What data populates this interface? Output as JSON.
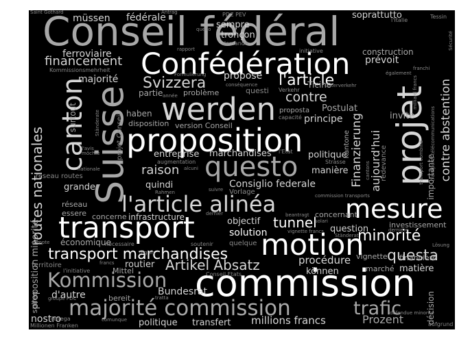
{
  "image": {
    "description_type": "word-cloud",
    "background": "#000000",
    "palette": {
      "white": "#ffffff",
      "light": "#d6d6d6",
      "gray": "#a8a8a8",
      "dim": "#8a8a8a"
    }
  },
  "words": [
    {
      "text": "Conseil fédéral",
      "color": "#a8a8a8"
    },
    {
      "text": "Confédération",
      "color": "#ffffff"
    },
    {
      "text": "werden",
      "color": "#d6d6d6"
    },
    {
      "text": "proposition",
      "color": "#ffffff"
    },
    {
      "text": "Suisse",
      "color": "#a8a8a8"
    },
    {
      "text": "canton",
      "color": "#d6d6d6"
    },
    {
      "text": "projet",
      "color": "#d6d6d6"
    },
    {
      "text": "questo",
      "color": "#a8a8a8"
    },
    {
      "text": "l'article alinéa",
      "color": "#d6d6d6"
    },
    {
      "text": "mesure",
      "color": "#ffffff"
    },
    {
      "text": "transport",
      "color": "#ffffff"
    },
    {
      "text": "motion",
      "color": "#ffffff"
    },
    {
      "text": "commission",
      "color": "#ffffff"
    },
    {
      "text": "majorité commission",
      "color": "#a8a8a8"
    },
    {
      "text": "Kommission",
      "color": "#a8a8a8"
    },
    {
      "text": "transport marchandises",
      "color": "#ffffff"
    },
    {
      "text": "Artikel Absatz",
      "color": "#d6d6d6"
    },
    {
      "text": "trafic",
      "color": "#a8a8a8"
    },
    {
      "text": "routes nationales",
      "color": "#d6d6d6"
    },
    {
      "text": "Svizzera",
      "color": "#d6d6d6"
    },
    {
      "text": "l'article",
      "color": "#ffffff"
    },
    {
      "text": "contre",
      "color": "#d6d6d6"
    },
    {
      "text": "minorité",
      "color": "#ffffff"
    },
    {
      "text": "questa",
      "color": "#d6d6d6"
    },
    {
      "text": "financement",
      "color": "#d6d6d6"
    },
    {
      "text": "Finanzierung",
      "color": "#d6d6d6"
    },
    {
      "text": "contre abstention",
      "color": "#d6d6d6"
    },
    {
      "text": "aujourd'hui",
      "color": "#d6d6d6"
    },
    {
      "text": "raison",
      "color": "#d6d6d6"
    },
    {
      "text": "tunnel",
      "color": "#ffffff"
    },
    {
      "text": "Prozent",
      "color": "#a8a8a8"
    },
    {
      "text": "millions francs",
      "color": "#d6d6d6"
    },
    {
      "text": "Consiglio federale",
      "color": "#d6d6d6"
    },
    {
      "text": "solution",
      "color": "#ffffff"
    },
    {
      "text": "procédure",
      "color": "#d6d6d6"
    },
    {
      "text": "Bundesrat",
      "color": "#d6d6d6"
    },
    {
      "text": "d'autre",
      "color": "#d6d6d6"
    },
    {
      "text": "nostro",
      "color": "#d6d6d6"
    },
    {
      "text": "politique",
      "color": "#d6d6d6"
    },
    {
      "text": "transfert",
      "color": "#d6d6d6"
    },
    {
      "text": "müssen",
      "color": "#d6d6d6"
    },
    {
      "text": "fédérale",
      "color": "#d6d6d6"
    },
    {
      "text": "soprattutto",
      "color": "#d6d6d6"
    },
    {
      "text": "ferroviaire",
      "color": "#d6d6d6"
    },
    {
      "text": "prévoit",
      "color": "#d6d6d6"
    },
    {
      "text": "majorité",
      "color": "#d6d6d6"
    },
    {
      "text": "propose",
      "color": "#d6d6d6"
    },
    {
      "text": "sempre",
      "color": "#d6d6d6"
    },
    {
      "text": "tronçon",
      "color": "#d6d6d6"
    },
    {
      "text": "principe",
      "color": "#d6d6d6"
    },
    {
      "text": "Postulat",
      "color": "#a8a8a8"
    },
    {
      "text": "entreprise",
      "color": "#d6d6d6"
    },
    {
      "text": "marchandises",
      "color": "#d6d6d6"
    },
    {
      "text": "politique",
      "color": "#d6d6d6"
    },
    {
      "text": "manière",
      "color": "#d6d6d6"
    },
    {
      "text": "grande",
      "color": "#d6d6d6"
    },
    {
      "text": "quindi",
      "color": "#d6d6d6"
    },
    {
      "text": "objectif",
      "color": "#d6d6d6"
    },
    {
      "text": "question",
      "color": "#d6d6d6"
    },
    {
      "text": "économique",
      "color": "#a8a8a8"
    },
    {
      "text": "routier",
      "color": "#d6d6d6"
    },
    {
      "text": "können",
      "color": "#d6d6d6"
    },
    {
      "text": "matière",
      "color": "#d6d6d6"
    },
    {
      "text": "vignette",
      "color": "#a8a8a8"
    },
    {
      "text": "financière",
      "color": "#a8a8a8"
    },
    {
      "text": "importante",
      "color": "#a8a8a8"
    },
    {
      "text": "invite",
      "color": "#a8a8a8"
    },
    {
      "text": "construction",
      "color": "#a8a8a8"
    },
    {
      "text": "infrastructure",
      "color": "#d6d6d6"
    },
    {
      "text": "concerne",
      "color": "#a8a8a8"
    },
    {
      "text": "partie",
      "color": "#a8a8a8"
    },
    {
      "text": "problème",
      "color": "#a8a8a8"
    },
    {
      "text": "haben",
      "color": "#a8a8a8"
    },
    {
      "text": "disposition",
      "color": "#a8a8a8"
    },
    {
      "text": "version Conseil",
      "color": "#a8a8a8"
    },
    {
      "text": "proposition minorité",
      "color": "#a8a8a8"
    },
    {
      "text": "surtout",
      "color": "#a8a8a8"
    },
    {
      "text": "Ticino",
      "color": "#a8a8a8"
    },
    {
      "text": "proposta",
      "color": "#a8a8a8"
    },
    {
      "text": "Kantone",
      "color": "#a8a8a8"
    },
    {
      "text": "décision",
      "color": "#a8a8a8"
    },
    {
      "text": "essere",
      "color": "#a8a8a8"
    },
    {
      "text": "réseau",
      "color": "#a8a8a8"
    },
    {
      "text": "sollen",
      "color": "#a8a8a8"
    },
    {
      "text": "bereit",
      "color": "#a8a8a8"
    },
    {
      "text": "marché",
      "color": "#a8a8a8"
    },
    {
      "text": "investissement",
      "color": "#a8a8a8"
    },
    {
      "text": "concernant",
      "color": "#a8a8a8"
    },
    {
      "text": "Mittel",
      "color": "#a8a8a8"
    },
    {
      "text": "territoire",
      "color": "#8a8a8a"
    },
    {
      "text": "quelque",
      "color": "#8a8a8a"
    },
    {
      "text": "soutenir",
      "color": "#8a8a8a"
    },
    {
      "text": "Saint Gothard",
      "color": "#8a8a8a"
    },
    {
      "text": "Antrag",
      "color": "#8a8a8a"
    },
    {
      "text": "PDC PEV",
      "color": "#8a8a8a"
    },
    {
      "text": "Tessin",
      "color": "#8a8a8a"
    },
    {
      "text": "l'Italie",
      "color": "#8a8a8a"
    },
    {
      "text": "quello",
      "color": "#8a8a8a"
    },
    {
      "text": "demande",
      "color": "#8a8a8a"
    },
    {
      "text": "initiative",
      "color": "#8a8a8a"
    },
    {
      "text": "Kommissionsmehrheit",
      "color": "#8a8a8a"
    },
    {
      "text": "rapport",
      "color": "#8a8a8a"
    },
    {
      "text": "Formulierung",
      "color": "#8a8a8a"
    },
    {
      "text": "conséquence",
      "color": "#8a8a8a"
    },
    {
      "text": "questi",
      "color": "#8a8a8a"
    },
    {
      "text": "Verkehr",
      "color": "#8a8a8a"
    },
    {
      "text": "capacité",
      "color": "#8a8a8a"
    },
    {
      "text": "Strasse",
      "color": "#8a8a8a"
    },
    {
      "text": "l'Etat",
      "color": "#8a8a8a"
    },
    {
      "text": "Vorlage",
      "color": "#8a8a8a"
    },
    {
      "text": "suivre",
      "color": "#8a8a8a"
    },
    {
      "text": "Rahmen",
      "color": "#8a8a8a"
    },
    {
      "text": "réseau routes",
      "color": "#8a8a8a"
    },
    {
      "text": "nationale",
      "color": "#8a8a8a"
    },
    {
      "text": "compte",
      "color": "#8a8a8a"
    },
    {
      "text": "nécessaire",
      "color": "#8a8a8a"
    },
    {
      "text": "région",
      "color": "#8a8a8a"
    },
    {
      "text": "francs",
      "color": "#8a8a8a"
    },
    {
      "text": "l'initiative",
      "color": "#8a8a8a"
    },
    {
      "text": "Conseil Etats",
      "color": "#8a8a8a"
    },
    {
      "text": "groupe PDC",
      "color": "#8a8a8a"
    },
    {
      "text": "collega",
      "color": "#8a8a8a"
    },
    {
      "text": "comunque",
      "color": "#8a8a8a"
    },
    {
      "text": "Millionen Franken",
      "color": "#8a8a8a"
    },
    {
      "text": "tratta",
      "color": "#8a8a8a"
    },
    {
      "text": "défendue minorité",
      "color": "#8a8a8a"
    },
    {
      "text": "aufgrund",
      "color": "#8a8a8a"
    },
    {
      "text": "Lösung",
      "color": "#8a8a8a"
    },
    {
      "text": "Ständerat",
      "color": "#8a8a8a"
    },
    {
      "text": "vignette francs",
      "color": "#8a8a8a"
    },
    {
      "text": "beantragt",
      "color": "#8a8a8a"
    },
    {
      "text": "dernier",
      "color": "#8a8a8a"
    },
    {
      "text": "milliard francs",
      "color": "#8a8a8a"
    },
    {
      "text": "transports télécommunications",
      "color": "#8a8a8a"
    },
    {
      "text": "Sécurité",
      "color": "#8a8a8a"
    },
    {
      "text": "transport combiné",
      "color": "#8a8a8a"
    },
    {
      "text": "redevance",
      "color": "#8a8a8a"
    },
    {
      "text": "également",
      "color": "#8a8a8a"
    },
    {
      "text": "franchi",
      "color": "#8a8a8a"
    },
    {
      "text": "projet Conseil",
      "color": "#8a8a8a"
    },
    {
      "text": "augmentation",
      "color": "#8a8a8a"
    },
    {
      "text": "l'avis",
      "color": "#8a8a8a"
    },
    {
      "text": "année",
      "color": "#8a8a8a"
    },
    {
      "text": "Ständerate",
      "color": "#8a8a8a"
    },
    {
      "text": "möchte",
      "color": "#8a8a8a"
    },
    {
      "text": "alcuni",
      "color": "#8a8a8a"
    },
    {
      "text": "Güterverkehr",
      "color": "#8a8a8a"
    },
    {
      "text": "solari",
      "color": "#8a8a8a"
    },
    {
      "text": "dernière",
      "color": "#8a8a8a"
    },
    {
      "text": "commission transports",
      "color": "#8a8a8a"
    },
    {
      "text": "cantons",
      "color": "#8a8a8a"
    }
  ]
}
